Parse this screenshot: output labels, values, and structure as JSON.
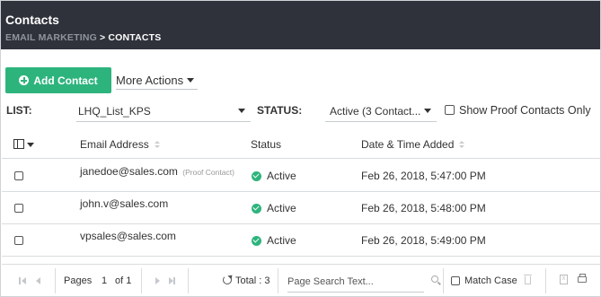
{
  "header": {
    "title": "Contacts",
    "breadcrumb": {
      "parent": "EMAIL MARKETING",
      "separator": ">",
      "current": "CONTACTS"
    }
  },
  "toolbar": {
    "add_contact_label": "Add Contact",
    "more_actions_label": "More Actions"
  },
  "filters": {
    "list_label": "LIST:",
    "list_value": "LHQ_List_KPS",
    "status_label": "STATUS:",
    "status_value": "Active (3 Contact...",
    "show_proof_label": "Show Proof Contacts Only"
  },
  "table": {
    "columns": [
      "Email Address",
      "Status",
      "Date & Time Added"
    ],
    "rows": [
      {
        "email": "janedoe@sales.com",
        "tag": "(Proof Contact)",
        "status": "Active",
        "date": "Feb 26, 2018, 5:47:00 PM"
      },
      {
        "email": "john.v@sales.com",
        "tag": "",
        "status": "Active",
        "date": "Feb 26, 2018, 5:48:00 PM"
      },
      {
        "email": "vpsales@sales.com",
        "tag": "",
        "status": "Active",
        "date": "Feb 26, 2018, 5:49:00 PM"
      }
    ]
  },
  "pager": {
    "pages_label": "Pages",
    "current_page": "1",
    "of_label": "of 1",
    "total_label": "Total : 3",
    "search_placeholder": "Page Search Text...",
    "match_case_label": "Match Case"
  },
  "colors": {
    "accent": "#2db47d",
    "header_bg": "#2f323a"
  },
  "icons": [
    "plus-circle-icon",
    "caret-down-icon",
    "column-chooser-icon",
    "sort-icon",
    "check-circle-icon",
    "first-page-icon",
    "prev-page-icon",
    "next-page-icon",
    "last-page-icon",
    "refresh-icon",
    "search-icon",
    "trash-icon",
    "excel-icon",
    "print-icon"
  ]
}
